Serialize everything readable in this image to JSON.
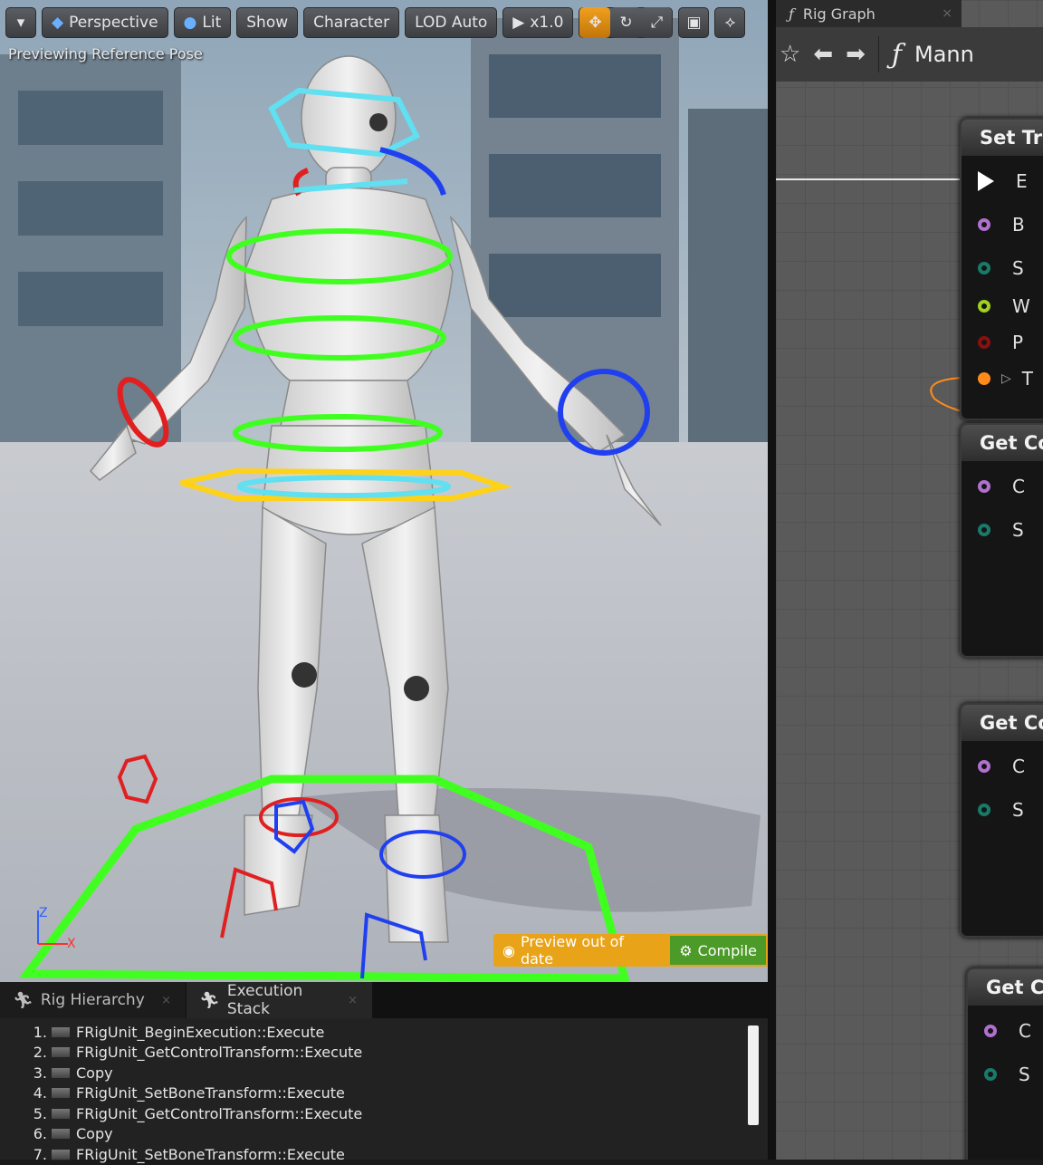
{
  "viewport": {
    "toolbar": {
      "menu_icon": "chevron-down-icon",
      "perspective": "Perspective",
      "lit": "Lit",
      "show": "Show",
      "character": "Character",
      "lod": "LOD Auto",
      "play_speed": "x1.0"
    },
    "preview_label": "Previewing Reference Pose",
    "status": {
      "warning": "Preview out of date",
      "compile": "Compile"
    },
    "axis": {
      "z": "Z",
      "x": "X"
    }
  },
  "graph": {
    "tab_title": "Rig Graph",
    "toolbar_name": "Mann",
    "nodes": [
      {
        "title": "Set Tra",
        "pins": [
          {
            "label": "E",
            "color": "#ffffff",
            "kind": "exec"
          },
          {
            "label": "B",
            "color": "#b070d0"
          },
          {
            "label": "S",
            "color": "#1a7a6a"
          },
          {
            "label": "W",
            "color": "#a0d020"
          },
          {
            "label": "P",
            "color": "#8a1010"
          },
          {
            "label": "T",
            "color": "#ff8c1a",
            "kind": "struct"
          }
        ]
      },
      {
        "title": "Get Co",
        "pins": [
          {
            "label": "C",
            "color": "#b070d0"
          },
          {
            "label": "S",
            "color": "#1a7a6a"
          }
        ]
      },
      {
        "title": "Get Co",
        "pins": [
          {
            "label": "C",
            "color": "#b070d0"
          },
          {
            "label": "S",
            "color": "#1a7a6a"
          }
        ]
      },
      {
        "title": "Get Co",
        "pins": [
          {
            "label": "C",
            "color": "#b070d0"
          },
          {
            "label": "S",
            "color": "#1a7a6a"
          }
        ]
      }
    ]
  },
  "panel": {
    "tabs": [
      "Rig Hierarchy",
      "Execution Stack"
    ],
    "execution_stack": [
      "FRigUnit_BeginExecution::Execute",
      "FRigUnit_GetControlTransform::Execute",
      "Copy",
      "FRigUnit_SetBoneTransform::Execute",
      "FRigUnit_GetControlTransform::Execute",
      "Copy",
      "FRigUnit_SetBoneTransform::Execute"
    ]
  },
  "colors": {
    "accent": "#e9a318",
    "compile_green": "#4c9a28",
    "control_green": "#40ff20",
    "control_yellow": "#ffd21a",
    "control_cyan": "#60e0f0"
  }
}
